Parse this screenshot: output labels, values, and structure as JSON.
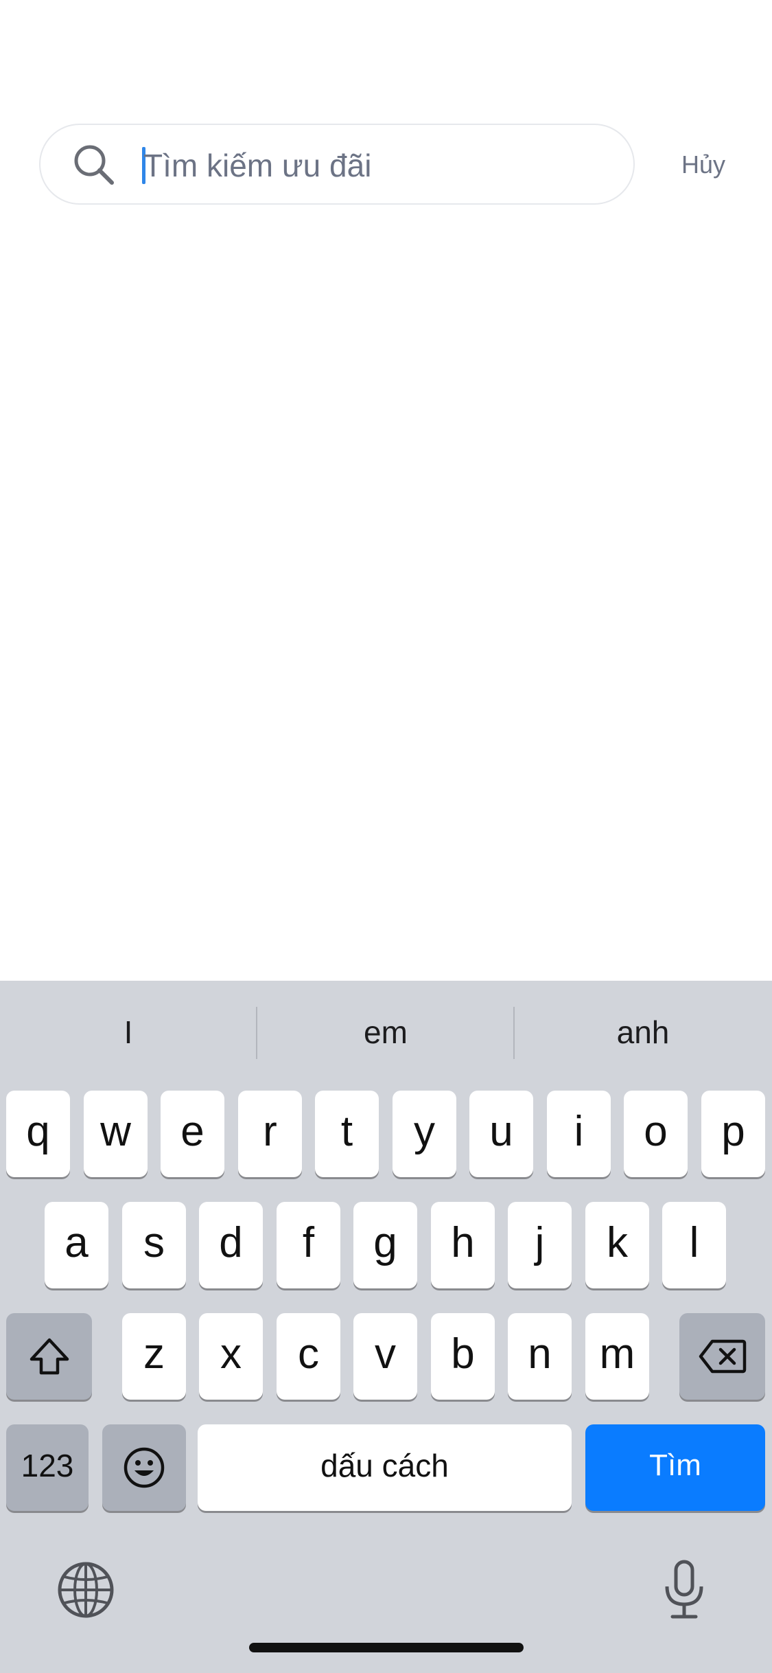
{
  "search": {
    "placeholder": "Tìm kiếm ưu đãi",
    "value": "",
    "cancel_label": "Hủy"
  },
  "keyboard": {
    "suggestions": [
      "I",
      "em",
      "anh"
    ],
    "row1": [
      "q",
      "w",
      "e",
      "r",
      "t",
      "y",
      "u",
      "i",
      "o",
      "p"
    ],
    "row2": [
      "a",
      "s",
      "d",
      "f",
      "g",
      "h",
      "j",
      "k",
      "l"
    ],
    "row3": [
      "z",
      "x",
      "c",
      "v",
      "b",
      "n",
      "m"
    ],
    "numbers_label": "123",
    "space_label": "dấu cách",
    "return_label": "Tìm",
    "icons": {
      "shift": "shift-icon",
      "delete": "backspace-icon",
      "emoji": "emoji-icon",
      "globe": "globe-icon",
      "mic": "microphone-icon"
    },
    "accent_color": "#0a7cff"
  }
}
